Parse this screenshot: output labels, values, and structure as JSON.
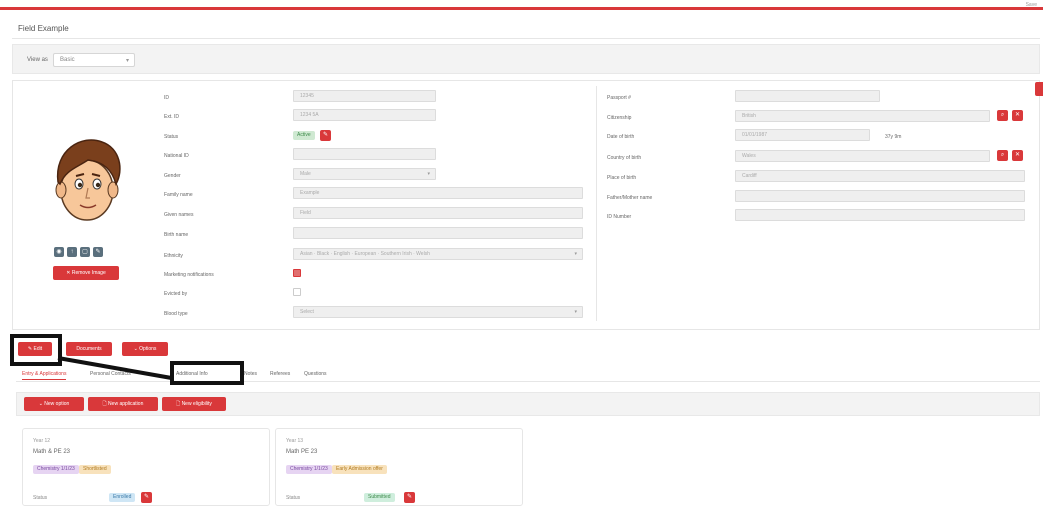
{
  "header": {
    "title": "Field Example",
    "right_text": "Save"
  },
  "view": {
    "label": "View as",
    "value": "Basic"
  },
  "avatar": {
    "remove_label": "Remove Image",
    "tools": [
      "camera-icon",
      "upload-icon",
      "crop-icon",
      "edit-icon"
    ]
  },
  "left_fields": [
    {
      "label": "ID",
      "value": "12345"
    },
    {
      "label": "Ext. ID",
      "value": "1234 5A"
    },
    {
      "label": "Status",
      "badge": "Active"
    },
    {
      "label": "National ID",
      "value": ""
    },
    {
      "label": "Gender",
      "value": "Male"
    },
    {
      "label": "Family name",
      "value": "Example"
    },
    {
      "label": "Given names",
      "value": "Field"
    },
    {
      "label": "Birth name",
      "value": ""
    },
    {
      "label": "Ethnicity",
      "value": "Asian · Black · English · European · Southern Irish · Welsh"
    },
    {
      "label": "Marketing notifications",
      "checked": true
    },
    {
      "label": "Evicted by",
      "checked": false
    },
    {
      "label": "Blood type",
      "value": "Select"
    }
  ],
  "right_fields": [
    {
      "label": "Passport #",
      "value": ""
    },
    {
      "label": "Citizenship",
      "value": "British"
    },
    {
      "label": "Date of birth",
      "value": "01/01/1987",
      "extra": "37y 9m"
    },
    {
      "label": "Country of birth",
      "value": "Wales"
    },
    {
      "label": "Place of birth",
      "value": "Cardiff"
    },
    {
      "label": "Father/Mother name",
      "value": ""
    },
    {
      "label": "ID Number",
      "value": ""
    }
  ],
  "actions": {
    "edit": "Edit",
    "documents": "Documents",
    "options": "Options"
  },
  "tabs": [
    "Entry & Applications",
    "Personal Contacts",
    "Additional Info",
    "Notes",
    "Referees",
    "Questions"
  ],
  "sub_actions": {
    "new_option": "New option",
    "new_application": "New application",
    "new_eligibility": "New eligibility"
  },
  "cards": [
    {
      "sub": "Year 12",
      "title": "Math & PE 23",
      "tag1": "Chemistry 1/1/23",
      "tag2": "Shortlisted",
      "status_label": "Status",
      "status": "Enrolled"
    },
    {
      "sub": "Year 13",
      "title": "Math PE 23",
      "tag1": "Chemistry 1/1/23",
      "tag2": "Early Admission offer",
      "status_label": "Status",
      "status": "Submitted"
    }
  ],
  "colors": {
    "accent": "#d9383a",
    "highlight": "#111111"
  }
}
